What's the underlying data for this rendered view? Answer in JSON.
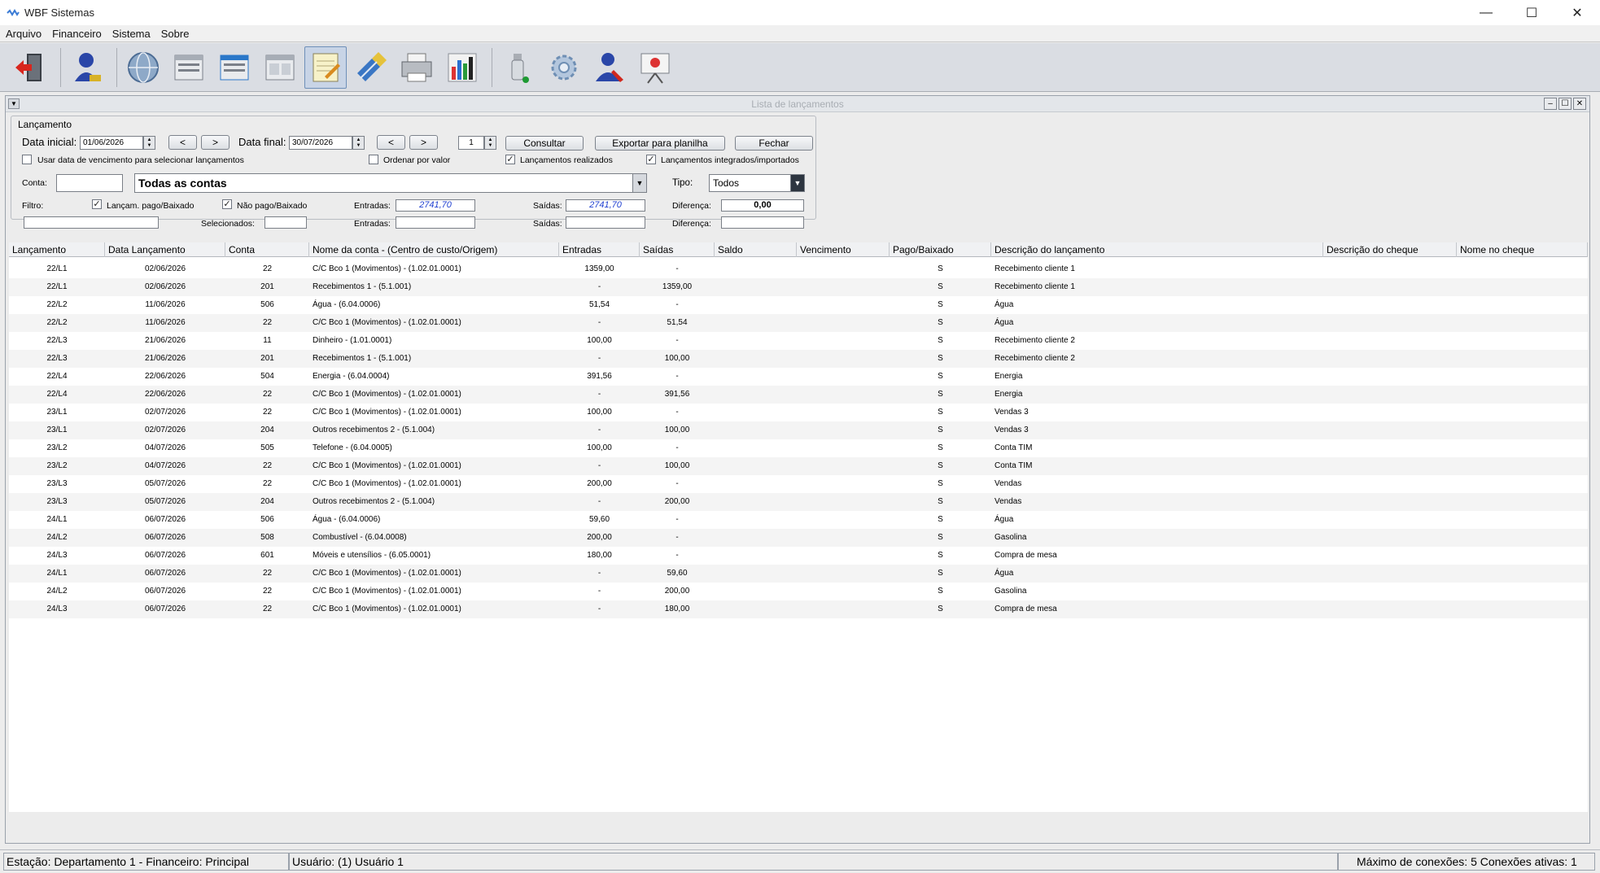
{
  "window": {
    "title": "WBF Sistemas",
    "minimize": "—",
    "maximize": "☐",
    "close": "✕"
  },
  "menu": [
    {
      "label": "Arquivo"
    },
    {
      "label": "Financeiro"
    },
    {
      "label": "Sistema"
    },
    {
      "label": "Sobre"
    }
  ],
  "toolbar": [
    {
      "name": "exit-icon"
    },
    {
      "name": "user-icon"
    },
    {
      "name": "globe-icon"
    },
    {
      "name": "register-icon-1"
    },
    {
      "name": "register-icon-2"
    },
    {
      "name": "register-icon-3"
    },
    {
      "name": "notepad-icon",
      "active": true
    },
    {
      "name": "edit-icon"
    },
    {
      "name": "printer-icon"
    },
    {
      "name": "chart-icon"
    },
    {
      "name": "usb-icon"
    },
    {
      "name": "settings-icon"
    },
    {
      "name": "user-admin-icon"
    },
    {
      "name": "presentation-icon"
    }
  ],
  "frame": {
    "title": "Lista de lançamentos"
  },
  "filter": {
    "group_label": "Lançamento",
    "data_inicial_label": "Data inicial:",
    "data_inicial": "01/06/2026",
    "prev": "<",
    "next": ">",
    "data_final_label": "Data final:",
    "data_final": "30/07/2026",
    "page": "1",
    "consultar": "Consultar",
    "exportar": "Exportar para planilha",
    "fechar": "Fechar",
    "usar_vencimento": "Usar data de vencimento para selecionar lançamentos",
    "ordenar_valor": "Ordenar por valor",
    "lanc_realizados": "Lançamentos realizados",
    "lanc_integrados": "Lançamentos integrados/importados",
    "conta_label": "Conta:",
    "conta_value": "",
    "conta_combo": "Todas as contas",
    "tipo_label": "Tipo:",
    "tipo_value": "Todos",
    "filtro_label": "Filtro:",
    "lancam_pago": "Lançam. pago/Baixado",
    "nao_pago": "Não pago/Baixado",
    "entradas_label": "Entradas:",
    "entradas_value": "2741,70",
    "saidas_label": "Saídas:",
    "saidas_value": "2741,70",
    "diferenca_label": "Diferença:",
    "diferenca_value": "0,00",
    "selecionados_label": "Selecionados:",
    "entradas2_label": "Entradas:",
    "saidas2_label": "Saídas:",
    "diferenca2_label": "Diferença:",
    "checks": {
      "usar_vencimento": false,
      "ordenar_valor": false,
      "lanc_realizados": true,
      "lanc_integrados": true,
      "lancam_pago": true,
      "nao_pago": true
    }
  },
  "table": {
    "columns": [
      "Lançamento",
      "Data Lançamento",
      "Conta",
      "Nome da conta - (Centro de custo/Origem)",
      "Entradas",
      "Saídas",
      "Saldo",
      "Vencimento",
      "Pago/Baixado",
      "Descrição do lançamento",
      "Descrição do cheque",
      "Nome no cheque"
    ],
    "rows": [
      [
        "22/L1",
        "02/06/2026",
        "22",
        "C/C Bco 1 (Movimentos) - (1.02.01.0001)",
        "1359,00",
        "-",
        "",
        "",
        "S",
        "Recebimento cliente 1"
      ],
      [
        "22/L1",
        "02/06/2026",
        "201",
        "Recebimentos 1 - (5.1.001)",
        "-",
        "1359,00",
        "",
        "",
        "S",
        "Recebimento cliente 1"
      ],
      [
        "22/L2",
        "11/06/2026",
        "506",
        "Água - (6.04.0006)",
        "51,54",
        "-",
        "",
        "",
        "S",
        "Água"
      ],
      [
        "22/L2",
        "11/06/2026",
        "22",
        "C/C Bco 1 (Movimentos) - (1.02.01.0001)",
        "-",
        "51,54",
        "",
        "",
        "S",
        "Água"
      ],
      [
        "22/L3",
        "21/06/2026",
        "11",
        "Dinheiro - (1.01.0001)",
        "100,00",
        "-",
        "",
        "",
        "S",
        "Recebimento cliente 2"
      ],
      [
        "22/L3",
        "21/06/2026",
        "201",
        "Recebimentos 1 - (5.1.001)",
        "-",
        "100,00",
        "",
        "",
        "S",
        "Recebimento cliente 2"
      ],
      [
        "22/L4",
        "22/06/2026",
        "504",
        "Energia - (6.04.0004)",
        "391,56",
        "-",
        "",
        "",
        "S",
        "Energia"
      ],
      [
        "22/L4",
        "22/06/2026",
        "22",
        "C/C Bco 1 (Movimentos) - (1.02.01.0001)",
        "-",
        "391,56",
        "",
        "",
        "S",
        "Energia"
      ],
      [
        "23/L1",
        "02/07/2026",
        "22",
        "C/C Bco 1 (Movimentos) - (1.02.01.0001)",
        "100,00",
        "-",
        "",
        "",
        "S",
        "Vendas 3"
      ],
      [
        "23/L1",
        "02/07/2026",
        "204",
        "Outros recebimentos 2 - (5.1.004)",
        "-",
        "100,00",
        "",
        "",
        "S",
        "Vendas 3"
      ],
      [
        "23/L2",
        "04/07/2026",
        "505",
        "Telefone - (6.04.0005)",
        "100,00",
        "-",
        "",
        "",
        "S",
        "Conta TIM"
      ],
      [
        "23/L2",
        "04/07/2026",
        "22",
        "C/C Bco 1 (Movimentos) - (1.02.01.0001)",
        "-",
        "100,00",
        "",
        "",
        "S",
        "Conta TIM"
      ],
      [
        "23/L3",
        "05/07/2026",
        "22",
        "C/C Bco 1 (Movimentos) - (1.02.01.0001)",
        "200,00",
        "-",
        "",
        "",
        "S",
        "Vendas"
      ],
      [
        "23/L3",
        "05/07/2026",
        "204",
        "Outros recebimentos 2 - (5.1.004)",
        "-",
        "200,00",
        "",
        "",
        "S",
        "Vendas"
      ],
      [
        "24/L1",
        "06/07/2026",
        "506",
        "Água - (6.04.0006)",
        "59,60",
        "-",
        "",
        "",
        "S",
        "Água"
      ],
      [
        "24/L2",
        "06/07/2026",
        "508",
        "Combustível - (6.04.0008)",
        "200,00",
        "-",
        "",
        "",
        "S",
        "Gasolina"
      ],
      [
        "24/L3",
        "06/07/2026",
        "601",
        "Móveis e utensílios - (6.05.0001)",
        "180,00",
        "-",
        "",
        "",
        "S",
        "Compra de mesa"
      ],
      [
        "24/L1",
        "06/07/2026",
        "22",
        "C/C Bco 1 (Movimentos) - (1.02.01.0001)",
        "-",
        "59,60",
        "",
        "",
        "S",
        "Água"
      ],
      [
        "24/L2",
        "06/07/2026",
        "22",
        "C/C Bco 1 (Movimentos) - (1.02.01.0001)",
        "-",
        "200,00",
        "",
        "",
        "S",
        "Gasolina"
      ],
      [
        "24/L3",
        "06/07/2026",
        "22",
        "C/C Bco 1 (Movimentos) - (1.02.01.0001)",
        "-",
        "180,00",
        "",
        "",
        "S",
        "Compra de mesa"
      ]
    ]
  },
  "status": {
    "estacao": "Estação: Departamento 1 - Financeiro: Principal",
    "usuario": "Usuário: (1) Usuário 1",
    "conexoes": "Máximo de conexões: 5 Conexões ativas: 1"
  }
}
